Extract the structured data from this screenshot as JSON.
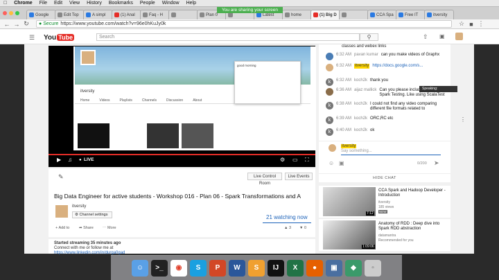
{
  "menubar": {
    "app": "Chrome",
    "items": [
      "File",
      "Edit",
      "View",
      "History",
      "Bookmarks",
      "People",
      "Window",
      "Help"
    ]
  },
  "share_banner": "You are sharing your screen",
  "tabs": [
    {
      "label": "Google"
    },
    {
      "label": "Edit Top"
    },
    {
      "label": "A simpl"
    },
    {
      "label": "(1) Anal"
    },
    {
      "label": "Faq - H"
    },
    {
      "label": ""
    },
    {
      "label": "Plan 0"
    },
    {
      "label": ""
    },
    {
      "label": "Latest"
    },
    {
      "label": "home"
    },
    {
      "label": "(1) Big D"
    },
    {
      "label": ""
    },
    {
      "label": "CCA Spa"
    },
    {
      "label": "Free IT"
    },
    {
      "label": "itversity"
    }
  ],
  "toolbar": {
    "secure": "Secure",
    "url": "https://www.youtube.com/watch?v=96e0hKuJy0k"
  },
  "youtube": {
    "logo_you": "You",
    "logo_tube": "Tube",
    "search_placeholder": "Search"
  },
  "player": {
    "channel": "itversity",
    "live": "LIVE",
    "popup_title": "good morning",
    "nav": [
      "Home",
      "Videos",
      "Playlists",
      "Channels",
      "Discussion",
      "About"
    ]
  },
  "buttons": {
    "live_control_room": "Live Control Room",
    "live_events": "Live Events"
  },
  "video": {
    "title": "Big Data Engineer for active students - Workshop 016 - Plan 06 - Spark Transformations and A",
    "channel": "itversity",
    "channel_settings": "Channel settings",
    "watching": "21 watching now",
    "add_to": "Add to",
    "share": "Share",
    "more": "More",
    "likes": "3",
    "dislikes": "0",
    "started": "Started streaming 35 minutes ago",
    "connect": "Connect with me or follow me at",
    "link": "https://www.linkedin.com/in/durga0gad"
  },
  "chat": {
    "top_text": "classes and webex links",
    "messages": [
      {
        "initial": "",
        "time": "6:32 AM",
        "author": "pavan kumar",
        "owner": false,
        "text": "can you make videos of Graphx"
      },
      {
        "initial": "",
        "time": "6:32 AM",
        "author": "itversity",
        "owner": true,
        "text": "https://docs.google.com/s..."
      },
      {
        "initial": "k",
        "time": "6:32 AM",
        "author": "koch2k",
        "owner": false,
        "text": "thank you"
      },
      {
        "initial": "",
        "time": "6:36 AM",
        "author": "aijaz mallick",
        "owner": false,
        "text": "Can you please include a series on Spark Testing. Like using ScalaTest"
      },
      {
        "initial": "k",
        "time": "6:38 AM",
        "author": "koch2k",
        "owner": false,
        "text": "I could not find any video comparing different file formats related to"
      },
      {
        "initial": "k",
        "time": "6:39 AM",
        "author": "koch2k",
        "owner": false,
        "text": "ORC,RC etc"
      },
      {
        "initial": "k",
        "time": "6:40 AM",
        "author": "koch2k",
        "owner": false,
        "text": "ok"
      }
    ],
    "input_author": "itversity",
    "input_placeholder": "Say something...",
    "counter": "0/200",
    "hide": "HIDE CHAT",
    "tooltip": "Speaking:"
  },
  "recommendations": [
    {
      "title": "CCA Spark and Hadoop Developer - Introduction",
      "channel": "itversity",
      "views": "185 views",
      "badge": "NEW",
      "duration": "7:12"
    },
    {
      "title": "Anatomy of RDD : Deep dive into Spark RDD abstraction",
      "channel": "datamantra",
      "views": "Recommended for you",
      "badge": "",
      "duration": "1:09:06"
    }
  ]
}
